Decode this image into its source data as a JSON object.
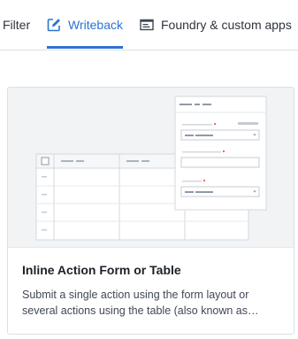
{
  "tabs": [
    {
      "label": "Filter"
    },
    {
      "label": "Writeback",
      "active": true
    },
    {
      "label": "Foundry & custom apps"
    }
  ],
  "card": {
    "title": "Inline Action Form or Table",
    "description": "Submit a single action using the form layout or several actions using the table (also known as…"
  },
  "colors": {
    "accent": "#2d72d2",
    "required": "#e76a6e"
  }
}
